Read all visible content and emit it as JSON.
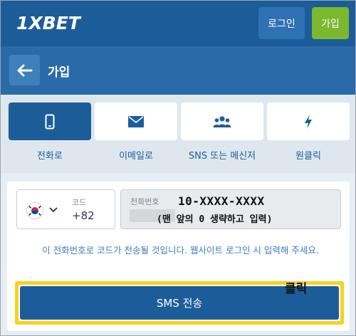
{
  "topbar": {
    "logo_text": "1XBET",
    "login_label": "로그인",
    "join_label": "가입"
  },
  "header": {
    "title": "가입",
    "back_icon": "arrow-left-icon"
  },
  "tabs": [
    {
      "label": "전화로",
      "icon": "smartphone-icon",
      "active": true
    },
    {
      "label": "이메일로",
      "icon": "envelope-icon",
      "active": false
    },
    {
      "label": "SNS 또는 메신저",
      "icon": "users-icon",
      "active": false
    },
    {
      "label": "원클릭",
      "icon": "lightning-icon",
      "active": false
    }
  ],
  "form": {
    "country": {
      "flag_icon": "south-korea-flag-icon",
      "code_label": "코드",
      "code_value": "+82"
    },
    "phone": {
      "label": "전화번호"
    },
    "hint": "이 전화번호로 코드가 전송될 것입니다. 웹사이트 로그인 시 입력해 주세요.",
    "sms_button_label": "SMS 전송"
  },
  "annotations": {
    "phone_format": "10-XXXX-XXXX",
    "phone_note": "(맨 앞의 0 생략하고 입력)",
    "click_label": "클릭",
    "highlight_color": "#f6d21e"
  },
  "colors": {
    "brand_blue": "#1c5d99",
    "join_green": "#7bb72f"
  }
}
